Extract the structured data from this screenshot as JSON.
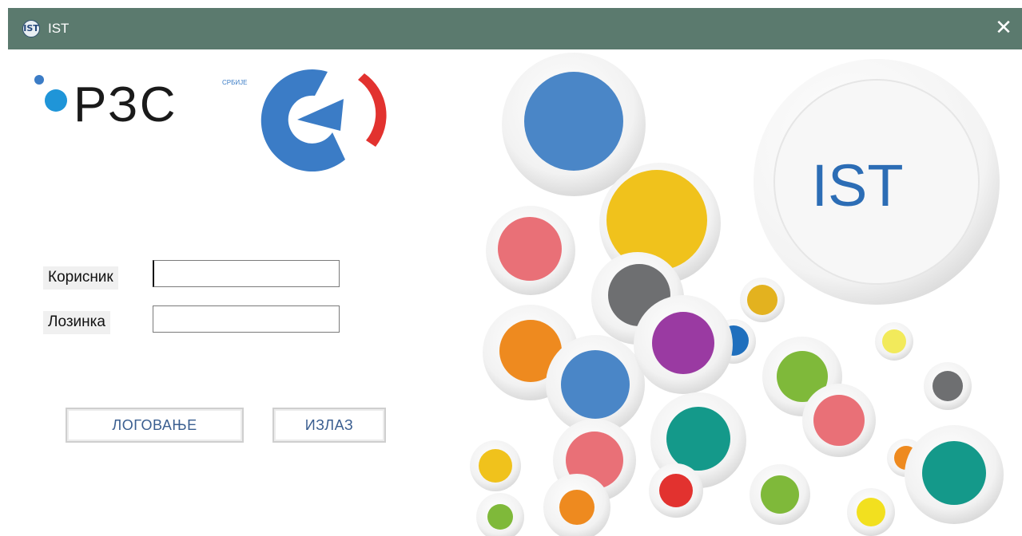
{
  "window": {
    "title": "IST",
    "app_icon": "IST",
    "close_glyph": "✕"
  },
  "logo": {
    "brand": "РЗС",
    "caption": "СРБИЈЕ"
  },
  "form": {
    "user_label": "Корисник",
    "user_value": "",
    "password_label": "Лозинка",
    "password_value": ""
  },
  "buttons": {
    "login": "ЛОГОВАЊЕ",
    "exit": "ИЗЛАЗ"
  },
  "decoration": {
    "bubble_text": "IST"
  },
  "colors": {
    "titlebar": "#5b7a6e",
    "logo_blue": "#3b7cc6",
    "logo_red": "#e2322f",
    "button_text": "#3a5e90",
    "bubble_text": "#2c6db5"
  }
}
